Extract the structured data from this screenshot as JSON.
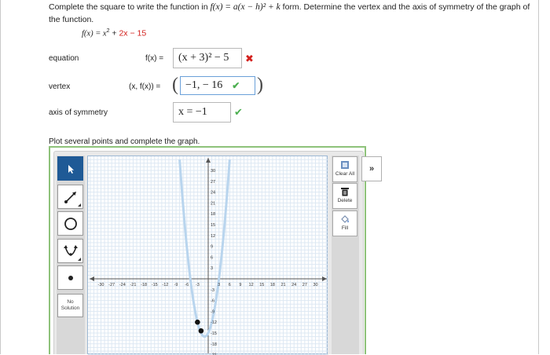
{
  "question": {
    "part1": "Complete the square to write the function in ",
    "form": "f(x) = a(x − h)² + k",
    "part2": " form. Determine the vertex and the axis of symmetry of the graph of the function."
  },
  "given": {
    "lhs": "f(x) = x",
    "exp": "2",
    "plus": " + ",
    "linear": "2x − 15"
  },
  "rows": {
    "equation": {
      "label": "equation",
      "lhs": "f(x) =",
      "answer": "(x + 3)² − 5",
      "status": "✖"
    },
    "vertex": {
      "label": "vertex",
      "lhs": "(x, f(x)) =",
      "answer": "−1, − 16",
      "status": "✔"
    },
    "axis": {
      "label": "axis of symmetry",
      "answer": "x = −1",
      "status": "✔"
    }
  },
  "graph": {
    "instruction": "Plot several points and complete the graph.",
    "no_solution": "No Solution",
    "clear_all": "Clear All",
    "delete": "Delete",
    "fill": "Fill",
    "expand": "»",
    "tools": [
      "pointer-icon",
      "line-ray-icon",
      "circle-icon",
      "parabola-icon",
      "point-icon"
    ],
    "x_ticks": [
      "-30",
      "-27",
      "-24",
      "-21",
      "-18",
      "-15",
      "-12",
      "-9",
      "-6",
      "-3",
      "3",
      "6",
      "9",
      "12",
      "15",
      "18",
      "21",
      "24",
      "27",
      "30"
    ],
    "y_ticks": [
      "30",
      "27",
      "24",
      "21",
      "18",
      "15",
      "12",
      "9",
      "6",
      "3",
      "-3",
      "-6",
      "-9",
      "-12",
      "-15",
      "-18",
      "-21"
    ],
    "curve_color": "#b9d5ee",
    "point_color": "#111111"
  }
}
